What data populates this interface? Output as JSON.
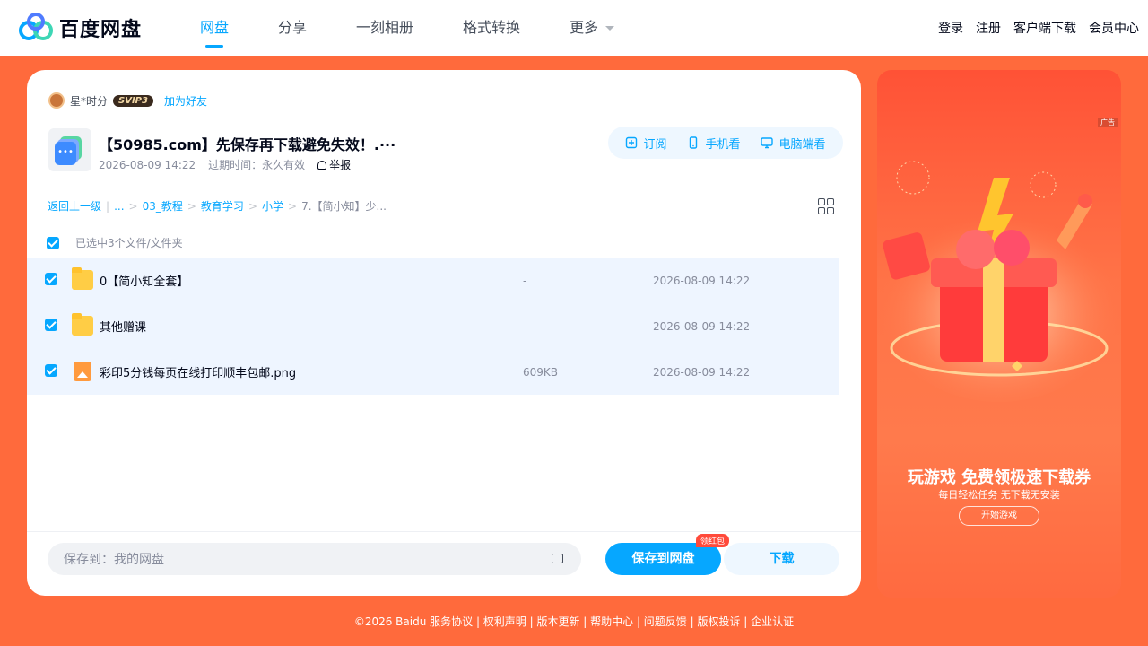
{
  "header": {
    "brand": "百度网盘",
    "nav": [
      {
        "label": "网盘",
        "active": true
      },
      {
        "label": "分享"
      },
      {
        "label": "一刻相册"
      },
      {
        "label": "格式转换"
      },
      {
        "label": "更多"
      }
    ],
    "right": [
      "登录",
      "注册",
      "客户端下载",
      "会员中心"
    ]
  },
  "sharer": {
    "name": "星*时分",
    "badge": "SVIP3",
    "add_friend": "加为好友"
  },
  "share": {
    "icon_text": "•••",
    "title": "【50985.com】先保存再下载避免失效！.···",
    "created": "2026-08-09 14:22",
    "expire_label": "过期时间：永久有效",
    "report": "举报"
  },
  "actions": {
    "subscribe": "订阅",
    "mobile": "手机看",
    "pc": "电脑端看"
  },
  "breadcrumb": {
    "back": "返回上一级",
    "ellipsis": "...",
    "items": [
      "03_教程",
      "教育学习",
      "小学",
      "7.【简小知】少..."
    ]
  },
  "selection": {
    "text": "已选中3个文件/文件夹"
  },
  "files": [
    {
      "name": "0【简小知全套】",
      "size": "-",
      "time": "2026-08-09 14:22",
      "type": "folder"
    },
    {
      "name": "其他赠课",
      "size": "-",
      "time": "2026-08-09 14:22",
      "type": "folder"
    },
    {
      "name": "彩印5分钱每页在线打印顺丰包邮.png",
      "size": "609KB",
      "time": "2026-08-09 14:22",
      "type": "image"
    }
  ],
  "bottom": {
    "save_to": "保存到：我的网盘",
    "save_button": "保存到网盘",
    "redpack": "领红包",
    "download_button": "下载"
  },
  "ad": {
    "tag": "广告",
    "title": "玩游戏 免费领极速下载券",
    "subtitle": "每日轻松任务 无下载无安装",
    "button": "开始游戏"
  },
  "footer": {
    "text": "©2026 Baidu  服务协议 | 权利声明 | 版本更新 | 帮助中心 | 问题反馈 | 版权投诉 | 企业认证"
  },
  "colors": {
    "accent": "#06a7ff",
    "background": "#ff6a3c",
    "row_selected": "#eef5ff"
  }
}
